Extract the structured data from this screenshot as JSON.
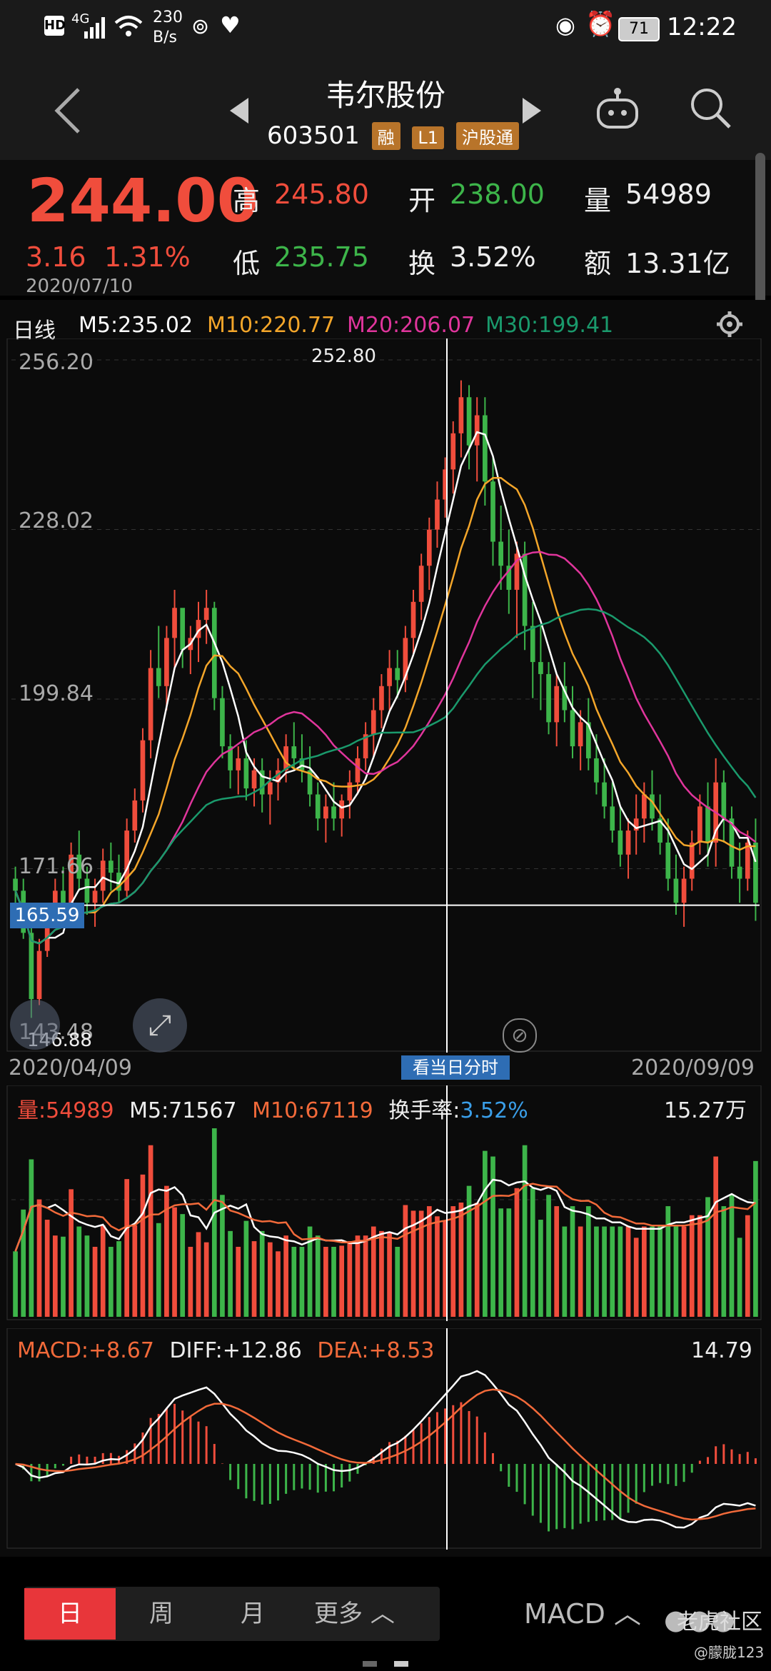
{
  "status": {
    "network": "4G",
    "speed": "230",
    "speed_unit": "B/s",
    "battery": "71",
    "time": "12:22"
  },
  "header": {
    "title": "韦尔股份",
    "code": "603501",
    "badges": [
      "融",
      "L1",
      "沪股通"
    ]
  },
  "quote": {
    "price": "244.00",
    "change": "3.16",
    "change_pct": "1.31%",
    "date": "2020/07/10",
    "high_label": "高",
    "high": "245.80",
    "low_label": "低",
    "low": "235.75",
    "open_label": "开",
    "open": "238.00",
    "turnover_label": "换",
    "turnover": "3.52%",
    "volume_label": "量",
    "volume": "54989",
    "amount_label": "额",
    "amount": "13.31亿"
  },
  "kline": {
    "period": "日线",
    "ma5": "M5:235.02",
    "ma10": "M10:220.77",
    "ma20": "M20:206.07",
    "ma30": "M30:199.41",
    "y_ticks": [
      "256.20",
      "228.02",
      "199.84",
      "171.66",
      "143.48"
    ],
    "max_marker": "252.80",
    "min_marker": "146.88",
    "crosshair_price": "165.59",
    "date_start": "2020/04/09",
    "date_end": "2020/09/09",
    "intraday_button": "看当日分时"
  },
  "volume": {
    "label_name": "量:",
    "label_val": "54989",
    "m5": "M5:71567",
    "m10": "M10:67119",
    "turnover_label": "换手率:",
    "turnover_val": "3.52%",
    "max": "15.27万"
  },
  "macd": {
    "macd": "MACD:+8.67",
    "diff": "DIFF:+12.86",
    "dea": "DEA:+8.53",
    "max": "14.79"
  },
  "nav": {
    "tabs": [
      "日",
      "周",
      "月",
      "更多"
    ],
    "indicator": "MACD",
    "watermark": "老虎社区",
    "user": "@朦胧123"
  },
  "colors": {
    "up": "#f04d3c",
    "down": "#3db54a",
    "ma5": "#ffffff",
    "ma10": "#f4a62a",
    "ma20": "#e0359c",
    "ma30": "#1a9a6c"
  },
  "chart_data": {
    "type": "candlestick",
    "x_range": [
      "2020/04/09",
      "2020/09/09"
    ],
    "ylim": [
      143.48,
      256.2
    ],
    "ohlc": [
      [
        170,
        172,
        165,
        168
      ],
      [
        168,
        170,
        160,
        161
      ],
      [
        161,
        163,
        146.88,
        150
      ],
      [
        150,
        160,
        149,
        158
      ],
      [
        158,
        166,
        157,
        164
      ],
      [
        164,
        170,
        162,
        168
      ],
      [
        168,
        172,
        163,
        165
      ],
      [
        165,
        176,
        164,
        174
      ],
      [
        174,
        178,
        168,
        170
      ],
      [
        170,
        172,
        164,
        166
      ],
      [
        166,
        170,
        162,
        168
      ],
      [
        168,
        175,
        166,
        173
      ],
      [
        173,
        176,
        168,
        171
      ],
      [
        171,
        174,
        166,
        168
      ],
      [
        168,
        180,
        167,
        178
      ],
      [
        178,
        185,
        176,
        183
      ],
      [
        183,
        195,
        181,
        193
      ],
      [
        193,
        208,
        190,
        205
      ],
      [
        205,
        212,
        200,
        202
      ],
      [
        202,
        212,
        198,
        210
      ],
      [
        210,
        218,
        205,
        215
      ],
      [
        215,
        214,
        205,
        208
      ],
      [
        208,
        212,
        204,
        210
      ],
      [
        210,
        216,
        206,
        213
      ],
      [
        213,
        218,
        209,
        215
      ],
      [
        215,
        216,
        198,
        200
      ],
      [
        200,
        202,
        190,
        192
      ],
      [
        192,
        194,
        185,
        188
      ],
      [
        188,
        192,
        184,
        190
      ],
      [
        190,
        193,
        183,
        185
      ],
      [
        185,
        190,
        182,
        188
      ],
      [
        188,
        190,
        181,
        184
      ],
      [
        184,
        188,
        179,
        186
      ],
      [
        186,
        190,
        183,
        188
      ],
      [
        188,
        194,
        186,
        192
      ],
      [
        192,
        196,
        188,
        190
      ],
      [
        190,
        194,
        186,
        188
      ],
      [
        188,
        192,
        182,
        184
      ],
      [
        184,
        186,
        178,
        180
      ],
      [
        180,
        184,
        176,
        182
      ],
      [
        182,
        186,
        178,
        180
      ],
      [
        180,
        184,
        177,
        183
      ],
      [
        183,
        188,
        180,
        186
      ],
      [
        186,
        192,
        184,
        190
      ],
      [
        190,
        196,
        188,
        194
      ],
      [
        194,
        200,
        190,
        198
      ],
      [
        198,
        204,
        195,
        202
      ],
      [
        202,
        208,
        198,
        205
      ],
      [
        205,
        208,
        200,
        203
      ],
      [
        203,
        212,
        201,
        210
      ],
      [
        210,
        218,
        207,
        216
      ],
      [
        216,
        224,
        213,
        222
      ],
      [
        222,
        230,
        218,
        228
      ],
      [
        228,
        236,
        225,
        233
      ],
      [
        233,
        240,
        230,
        238
      ],
      [
        238,
        246,
        234,
        244
      ],
      [
        244,
        252.8,
        240,
        250
      ],
      [
        250,
        252,
        238,
        242
      ],
      [
        242,
        250,
        236,
        247
      ],
      [
        247,
        250,
        232,
        236
      ],
      [
        236,
        240,
        222,
        226
      ],
      [
        226,
        232,
        218,
        222
      ],
      [
        222,
        228,
        214,
        218
      ],
      [
        218,
        226,
        210,
        224
      ],
      [
        224,
        226,
        208,
        212
      ],
      [
        212,
        216,
        200,
        206
      ],
      [
        206,
        212,
        198,
        204
      ],
      [
        204,
        206,
        194,
        196
      ],
      [
        196,
        204,
        192,
        202
      ],
      [
        202,
        206,
        196,
        198
      ],
      [
        198,
        202,
        190,
        192
      ],
      [
        192,
        198,
        188,
        196
      ],
      [
        196,
        200,
        188,
        190
      ],
      [
        190,
        194,
        184,
        186
      ],
      [
        186,
        190,
        180,
        182
      ],
      [
        182,
        186,
        176,
        178
      ],
      [
        178,
        182,
        172,
        174
      ],
      [
        174,
        180,
        170,
        178
      ],
      [
        178,
        184,
        174,
        180
      ],
      [
        180,
        186,
        176,
        184
      ],
      [
        184,
        188,
        178,
        180
      ],
      [
        180,
        184,
        174,
        176
      ],
      [
        176,
        180,
        168,
        170
      ],
      [
        170,
        174,
        164,
        166
      ],
      [
        166,
        172,
        162,
        170
      ],
      [
        170,
        178,
        168,
        176
      ],
      [
        176,
        184,
        174,
        182
      ],
      [
        182,
        186,
        172,
        176
      ],
      [
        176,
        190,
        172,
        186
      ],
      [
        186,
        188,
        176,
        180
      ],
      [
        180,
        182,
        170,
        172
      ],
      [
        172,
        176,
        166,
        170
      ],
      [
        170,
        178,
        168,
        176
      ],
      [
        176,
        180,
        163,
        166
      ]
    ],
    "volume_max": "15.27万"
  }
}
